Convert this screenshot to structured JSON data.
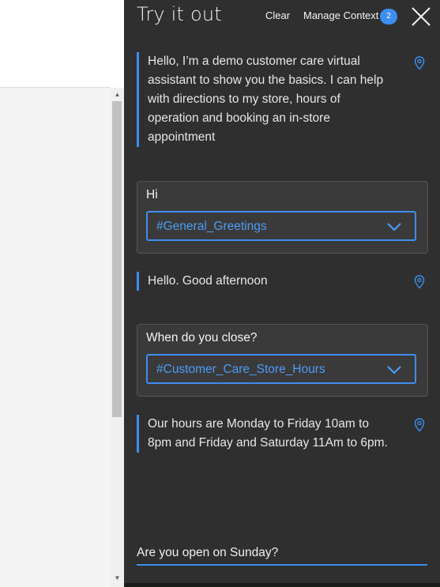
{
  "header": {
    "title": "Try it out",
    "clear_label": "Clear",
    "manage_context_label": "Manage Context",
    "context_count": "2"
  },
  "messages": {
    "bot_1": {
      "lines": [
        "Hello, I’m a demo customer care virtual",
        "assistant to show you the basics. I can help",
        "with directions to my store, hours of",
        "operation and booking an in-store",
        "appointment"
      ]
    },
    "user_1": {
      "text": "Hi",
      "intent": "#General_Greetings"
    },
    "bot_2": {
      "lines": [
        "Hello. Good afternoon"
      ]
    },
    "user_2": {
      "text": "When do you close?",
      "intent": "#Customer_Care_Store_Hours"
    },
    "bot_3": {
      "lines": [
        "Our hours are Monday to Friday 10am to",
        "8pm and Friday and Saturday 11Am to 6pm."
      ]
    }
  },
  "input": {
    "value": "Are you open on Sunday?"
  },
  "colors": {
    "accent": "#3d8ef0",
    "panel_bg": "#2f2f2f",
    "card_bg": "#3a3a3a"
  },
  "icons": {
    "close": "close-icon",
    "pin": "location-pin-icon",
    "chevron": "chevron-down-icon"
  }
}
